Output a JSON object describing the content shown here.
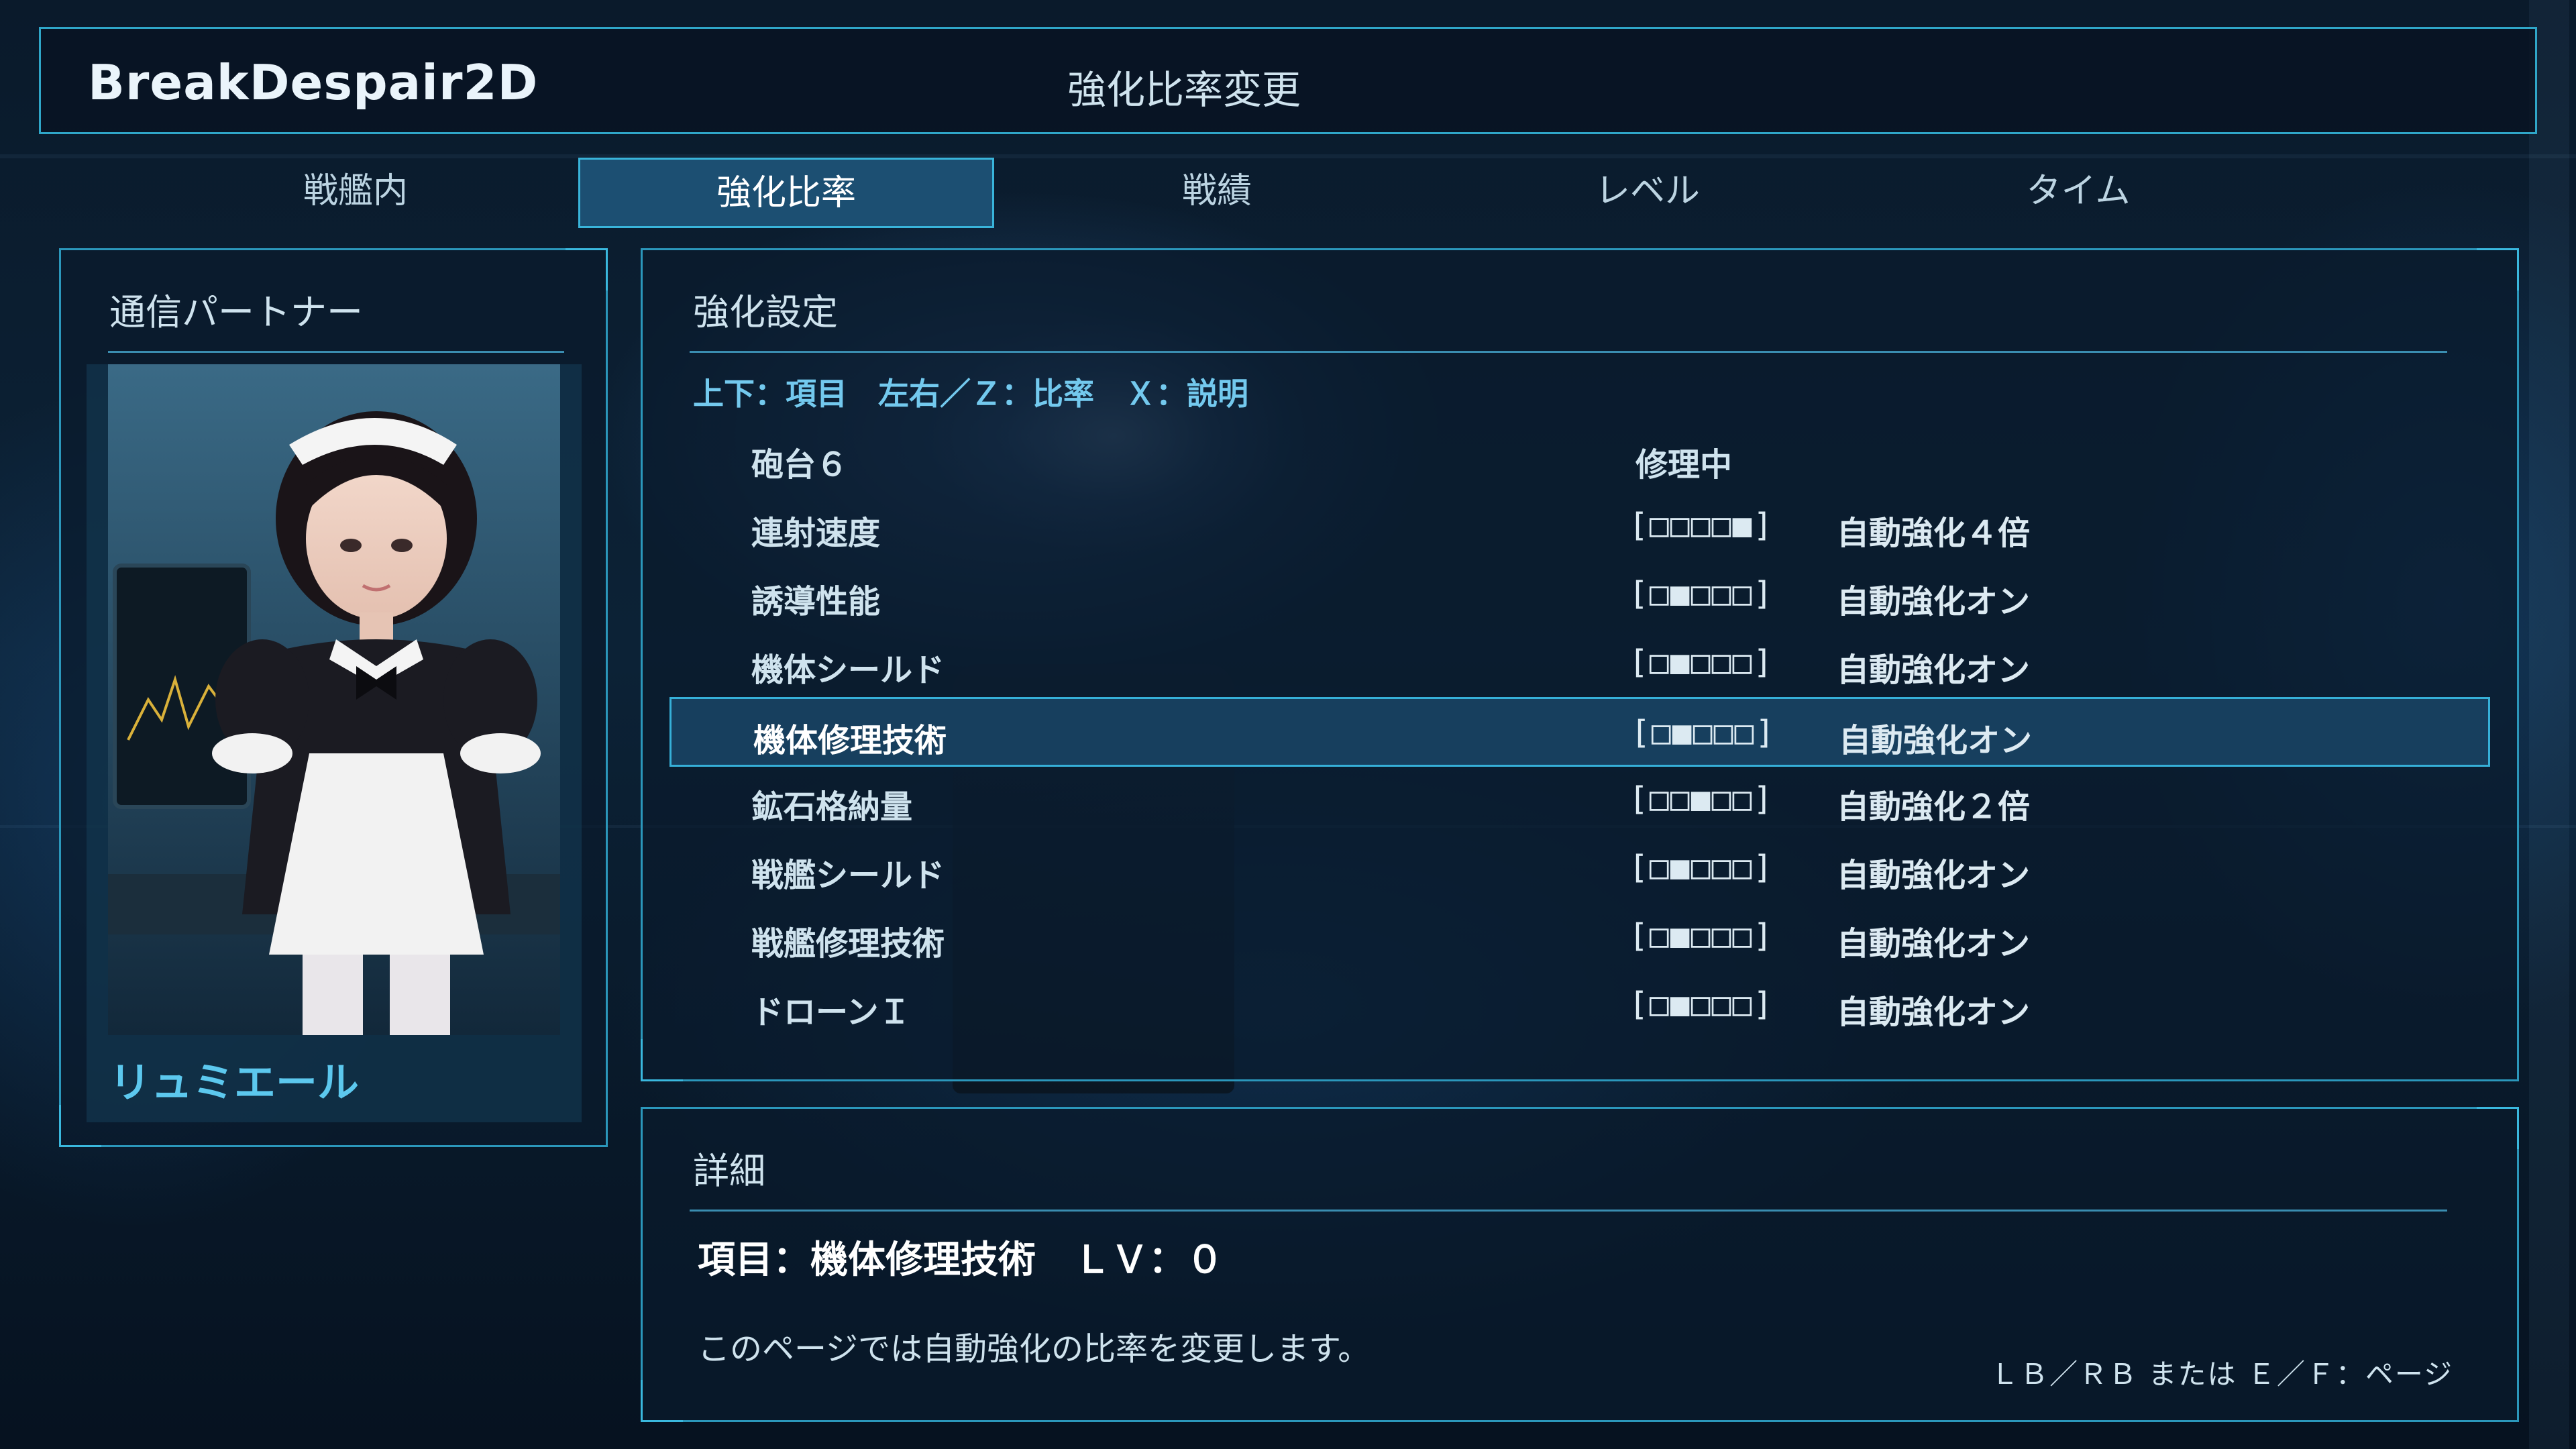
{
  "app": {
    "title": "BreakDespair2D",
    "screen_title": "強化比率変更"
  },
  "tabs": [
    {
      "label": "戦艦内",
      "active": false
    },
    {
      "label": "強化比率",
      "active": true
    },
    {
      "label": "戦績",
      "active": false
    },
    {
      "label": "レベル",
      "active": false
    },
    {
      "label": "タイム",
      "active": false
    }
  ],
  "partner": {
    "heading": "通信パートナー",
    "name": "リュミエール"
  },
  "settings": {
    "heading": "強化設定",
    "controls_hint": "上下：項目　左右／Ｚ：比率　Ｘ：説明",
    "selected_index": 4,
    "rows": [
      {
        "name": "砲台６",
        "status": "修理中",
        "gauge": "",
        "mode": ""
      },
      {
        "name": "連射速度",
        "status": "",
        "gauge": "[□□□□■]",
        "mode": "自動強化４倍"
      },
      {
        "name": "誘導性能",
        "status": "",
        "gauge": "[□■□□□]",
        "mode": "自動強化オン"
      },
      {
        "name": "機体シールド",
        "status": "",
        "gauge": "[□■□□□]",
        "mode": "自動強化オン"
      },
      {
        "name": "機体修理技術",
        "status": "",
        "gauge": "[□■□□□]",
        "mode": "自動強化オン"
      },
      {
        "name": "鉱石格納量",
        "status": "",
        "gauge": "[□□■□□]",
        "mode": "自動強化２倍"
      },
      {
        "name": "戦艦シールド",
        "status": "",
        "gauge": "[□■□□□]",
        "mode": "自動強化オン"
      },
      {
        "name": "戦艦修理技術",
        "status": "",
        "gauge": "[□■□□□]",
        "mode": "自動強化オン"
      },
      {
        "name": "ドローンＩ",
        "status": "",
        "gauge": "[□■□□□]",
        "mode": "自動強化オン"
      }
    ]
  },
  "details": {
    "heading": "詳細",
    "item_line": "項目：機体修理技術　ＬＶ：０",
    "description": "このページでは自動強化の比率を変更します。",
    "page_hint": "ＬＢ／ＲＢ または Ｅ／Ｆ：ページ"
  },
  "colors": {
    "accent": "#2fa6c8",
    "selected_bg": "#173f5e",
    "highlight_text": "#5cc8ee"
  }
}
